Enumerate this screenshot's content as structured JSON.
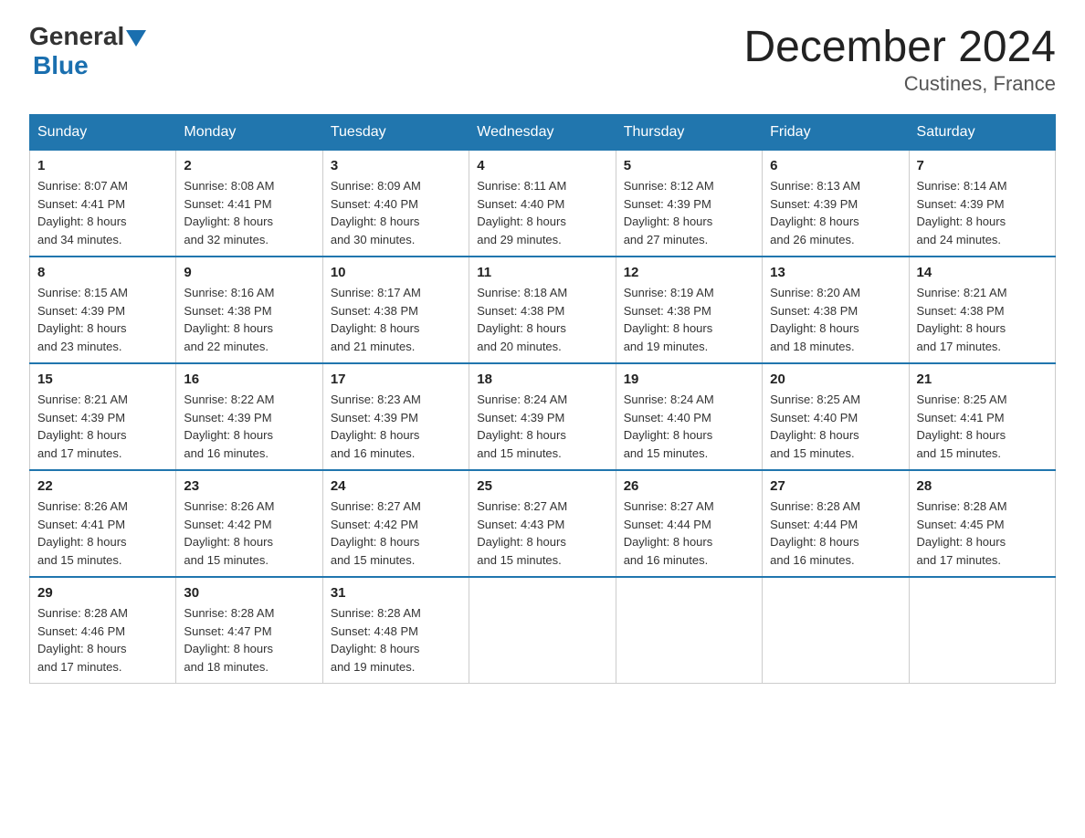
{
  "header": {
    "logo_general": "General",
    "logo_blue": "Blue",
    "title": "December 2024",
    "subtitle": "Custines, France"
  },
  "columns": [
    "Sunday",
    "Monday",
    "Tuesday",
    "Wednesday",
    "Thursday",
    "Friday",
    "Saturday"
  ],
  "weeks": [
    [
      {
        "day": "1",
        "info": "Sunrise: 8:07 AM\nSunset: 4:41 PM\nDaylight: 8 hours\nand 34 minutes."
      },
      {
        "day": "2",
        "info": "Sunrise: 8:08 AM\nSunset: 4:41 PM\nDaylight: 8 hours\nand 32 minutes."
      },
      {
        "day": "3",
        "info": "Sunrise: 8:09 AM\nSunset: 4:40 PM\nDaylight: 8 hours\nand 30 minutes."
      },
      {
        "day": "4",
        "info": "Sunrise: 8:11 AM\nSunset: 4:40 PM\nDaylight: 8 hours\nand 29 minutes."
      },
      {
        "day": "5",
        "info": "Sunrise: 8:12 AM\nSunset: 4:39 PM\nDaylight: 8 hours\nand 27 minutes."
      },
      {
        "day": "6",
        "info": "Sunrise: 8:13 AM\nSunset: 4:39 PM\nDaylight: 8 hours\nand 26 minutes."
      },
      {
        "day": "7",
        "info": "Sunrise: 8:14 AM\nSunset: 4:39 PM\nDaylight: 8 hours\nand 24 minutes."
      }
    ],
    [
      {
        "day": "8",
        "info": "Sunrise: 8:15 AM\nSunset: 4:39 PM\nDaylight: 8 hours\nand 23 minutes."
      },
      {
        "day": "9",
        "info": "Sunrise: 8:16 AM\nSunset: 4:38 PM\nDaylight: 8 hours\nand 22 minutes."
      },
      {
        "day": "10",
        "info": "Sunrise: 8:17 AM\nSunset: 4:38 PM\nDaylight: 8 hours\nand 21 minutes."
      },
      {
        "day": "11",
        "info": "Sunrise: 8:18 AM\nSunset: 4:38 PM\nDaylight: 8 hours\nand 20 minutes."
      },
      {
        "day": "12",
        "info": "Sunrise: 8:19 AM\nSunset: 4:38 PM\nDaylight: 8 hours\nand 19 minutes."
      },
      {
        "day": "13",
        "info": "Sunrise: 8:20 AM\nSunset: 4:38 PM\nDaylight: 8 hours\nand 18 minutes."
      },
      {
        "day": "14",
        "info": "Sunrise: 8:21 AM\nSunset: 4:38 PM\nDaylight: 8 hours\nand 17 minutes."
      }
    ],
    [
      {
        "day": "15",
        "info": "Sunrise: 8:21 AM\nSunset: 4:39 PM\nDaylight: 8 hours\nand 17 minutes."
      },
      {
        "day": "16",
        "info": "Sunrise: 8:22 AM\nSunset: 4:39 PM\nDaylight: 8 hours\nand 16 minutes."
      },
      {
        "day": "17",
        "info": "Sunrise: 8:23 AM\nSunset: 4:39 PM\nDaylight: 8 hours\nand 16 minutes."
      },
      {
        "day": "18",
        "info": "Sunrise: 8:24 AM\nSunset: 4:39 PM\nDaylight: 8 hours\nand 15 minutes."
      },
      {
        "day": "19",
        "info": "Sunrise: 8:24 AM\nSunset: 4:40 PM\nDaylight: 8 hours\nand 15 minutes."
      },
      {
        "day": "20",
        "info": "Sunrise: 8:25 AM\nSunset: 4:40 PM\nDaylight: 8 hours\nand 15 minutes."
      },
      {
        "day": "21",
        "info": "Sunrise: 8:25 AM\nSunset: 4:41 PM\nDaylight: 8 hours\nand 15 minutes."
      }
    ],
    [
      {
        "day": "22",
        "info": "Sunrise: 8:26 AM\nSunset: 4:41 PM\nDaylight: 8 hours\nand 15 minutes."
      },
      {
        "day": "23",
        "info": "Sunrise: 8:26 AM\nSunset: 4:42 PM\nDaylight: 8 hours\nand 15 minutes."
      },
      {
        "day": "24",
        "info": "Sunrise: 8:27 AM\nSunset: 4:42 PM\nDaylight: 8 hours\nand 15 minutes."
      },
      {
        "day": "25",
        "info": "Sunrise: 8:27 AM\nSunset: 4:43 PM\nDaylight: 8 hours\nand 15 minutes."
      },
      {
        "day": "26",
        "info": "Sunrise: 8:27 AM\nSunset: 4:44 PM\nDaylight: 8 hours\nand 16 minutes."
      },
      {
        "day": "27",
        "info": "Sunrise: 8:28 AM\nSunset: 4:44 PM\nDaylight: 8 hours\nand 16 minutes."
      },
      {
        "day": "28",
        "info": "Sunrise: 8:28 AM\nSunset: 4:45 PM\nDaylight: 8 hours\nand 17 minutes."
      }
    ],
    [
      {
        "day": "29",
        "info": "Sunrise: 8:28 AM\nSunset: 4:46 PM\nDaylight: 8 hours\nand 17 minutes."
      },
      {
        "day": "30",
        "info": "Sunrise: 8:28 AM\nSunset: 4:47 PM\nDaylight: 8 hours\nand 18 minutes."
      },
      {
        "day": "31",
        "info": "Sunrise: 8:28 AM\nSunset: 4:48 PM\nDaylight: 8 hours\nand 19 minutes."
      },
      null,
      null,
      null,
      null
    ]
  ]
}
